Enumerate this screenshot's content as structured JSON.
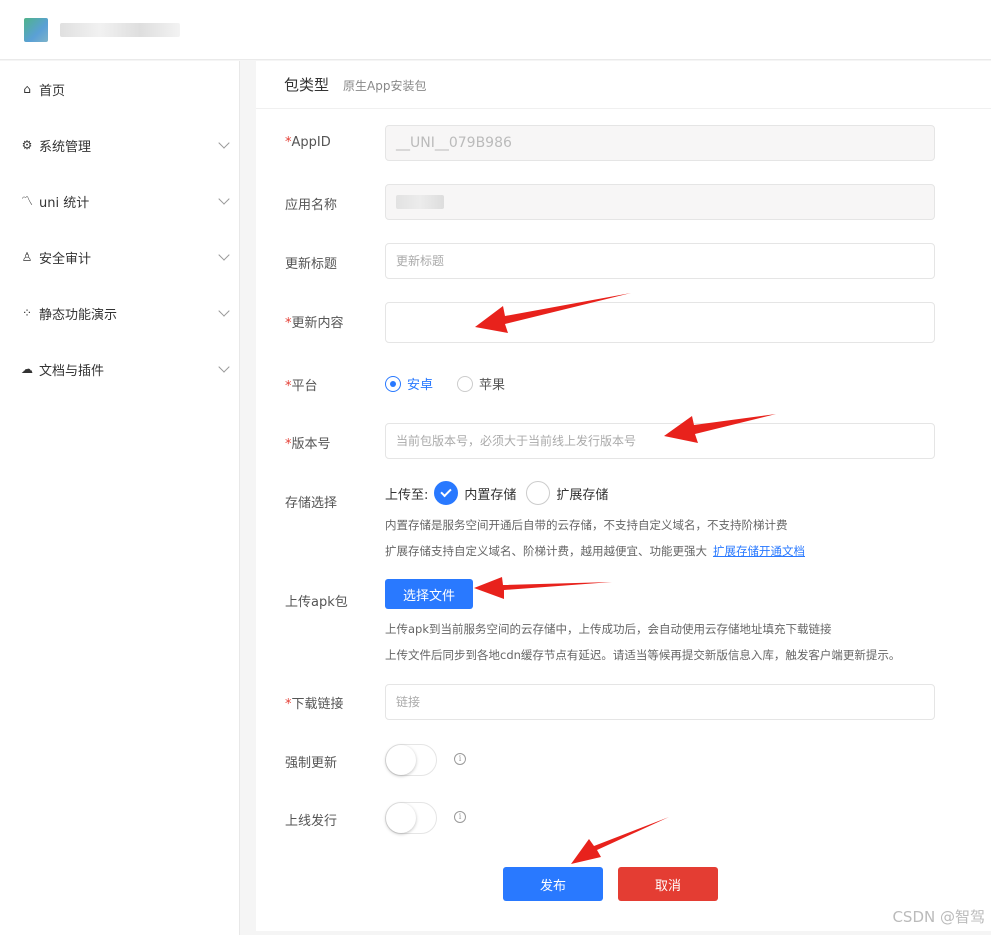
{
  "topbar": {
    "app_name": ""
  },
  "sidebar": {
    "items": [
      {
        "label": "首页",
        "icon": "home-icon",
        "glyph": "⌂",
        "expandable": false
      },
      {
        "label": "系统管理",
        "icon": "gear-icon",
        "glyph": "⚙",
        "expandable": true
      },
      {
        "label": "uni 统计",
        "icon": "chart-icon",
        "glyph": "〽",
        "expandable": true
      },
      {
        "label": "安全审计",
        "icon": "user-icon",
        "glyph": "♙",
        "expandable": true
      },
      {
        "label": "静态功能演示",
        "icon": "grid-icon",
        "glyph": "⁘",
        "expandable": true
      },
      {
        "label": "文档与插件",
        "icon": "cloud-icon",
        "glyph": "☁",
        "expandable": true
      }
    ]
  },
  "header": {
    "title": "包类型",
    "subtitle": "原生App安装包"
  },
  "form": {
    "appid": {
      "label": "AppID",
      "value": "__UNI__079B986"
    },
    "app_name": {
      "label": "应用名称",
      "value": ""
    },
    "update_title": {
      "label": "更新标题",
      "placeholder": "更新标题"
    },
    "update_content": {
      "label": "更新内容",
      "placeholder": ""
    },
    "platform": {
      "label": "平台",
      "options": [
        "安卓",
        "苹果"
      ],
      "selected": "安卓"
    },
    "version": {
      "label": "版本号",
      "placeholder": "当前包版本号，必须大于当前线上发行版本号"
    },
    "storage": {
      "label": "存储选择",
      "prefix": "上传至:",
      "options": [
        "内置存储",
        "扩展存储"
      ],
      "selected": "内置存储",
      "hint1": "内置存储是服务空间开通后自带的云存储，不支持自定义域名，不支持阶梯计费",
      "hint2": "扩展存储支持自定义域名、阶梯计费，越用越便宜、功能更强大",
      "hint2_link": "扩展存储开通文档"
    },
    "upload": {
      "label": "上传apk包",
      "button": "选择文件",
      "hint1": "上传apk到当前服务空间的云存储中，上传成功后，会自动使用云存储地址填充下载链接",
      "hint2": "上传文件后同步到各地cdn缓存节点有延迟。请适当等候再提交新版信息入库，触发客户端更新提示。"
    },
    "download": {
      "label": "下载链接",
      "placeholder": "链接"
    },
    "force_update": {
      "label": "强制更新",
      "on": false
    },
    "online": {
      "label": "上线发行",
      "on": false
    }
  },
  "actions": {
    "submit": "发布",
    "cancel": "取消"
  },
  "watermark": "CSDN @智驾",
  "colors": {
    "primary": "#2979ff",
    "danger": "#e43d33",
    "required": "#e43d33",
    "annotation_arrow": "#e8221c"
  }
}
